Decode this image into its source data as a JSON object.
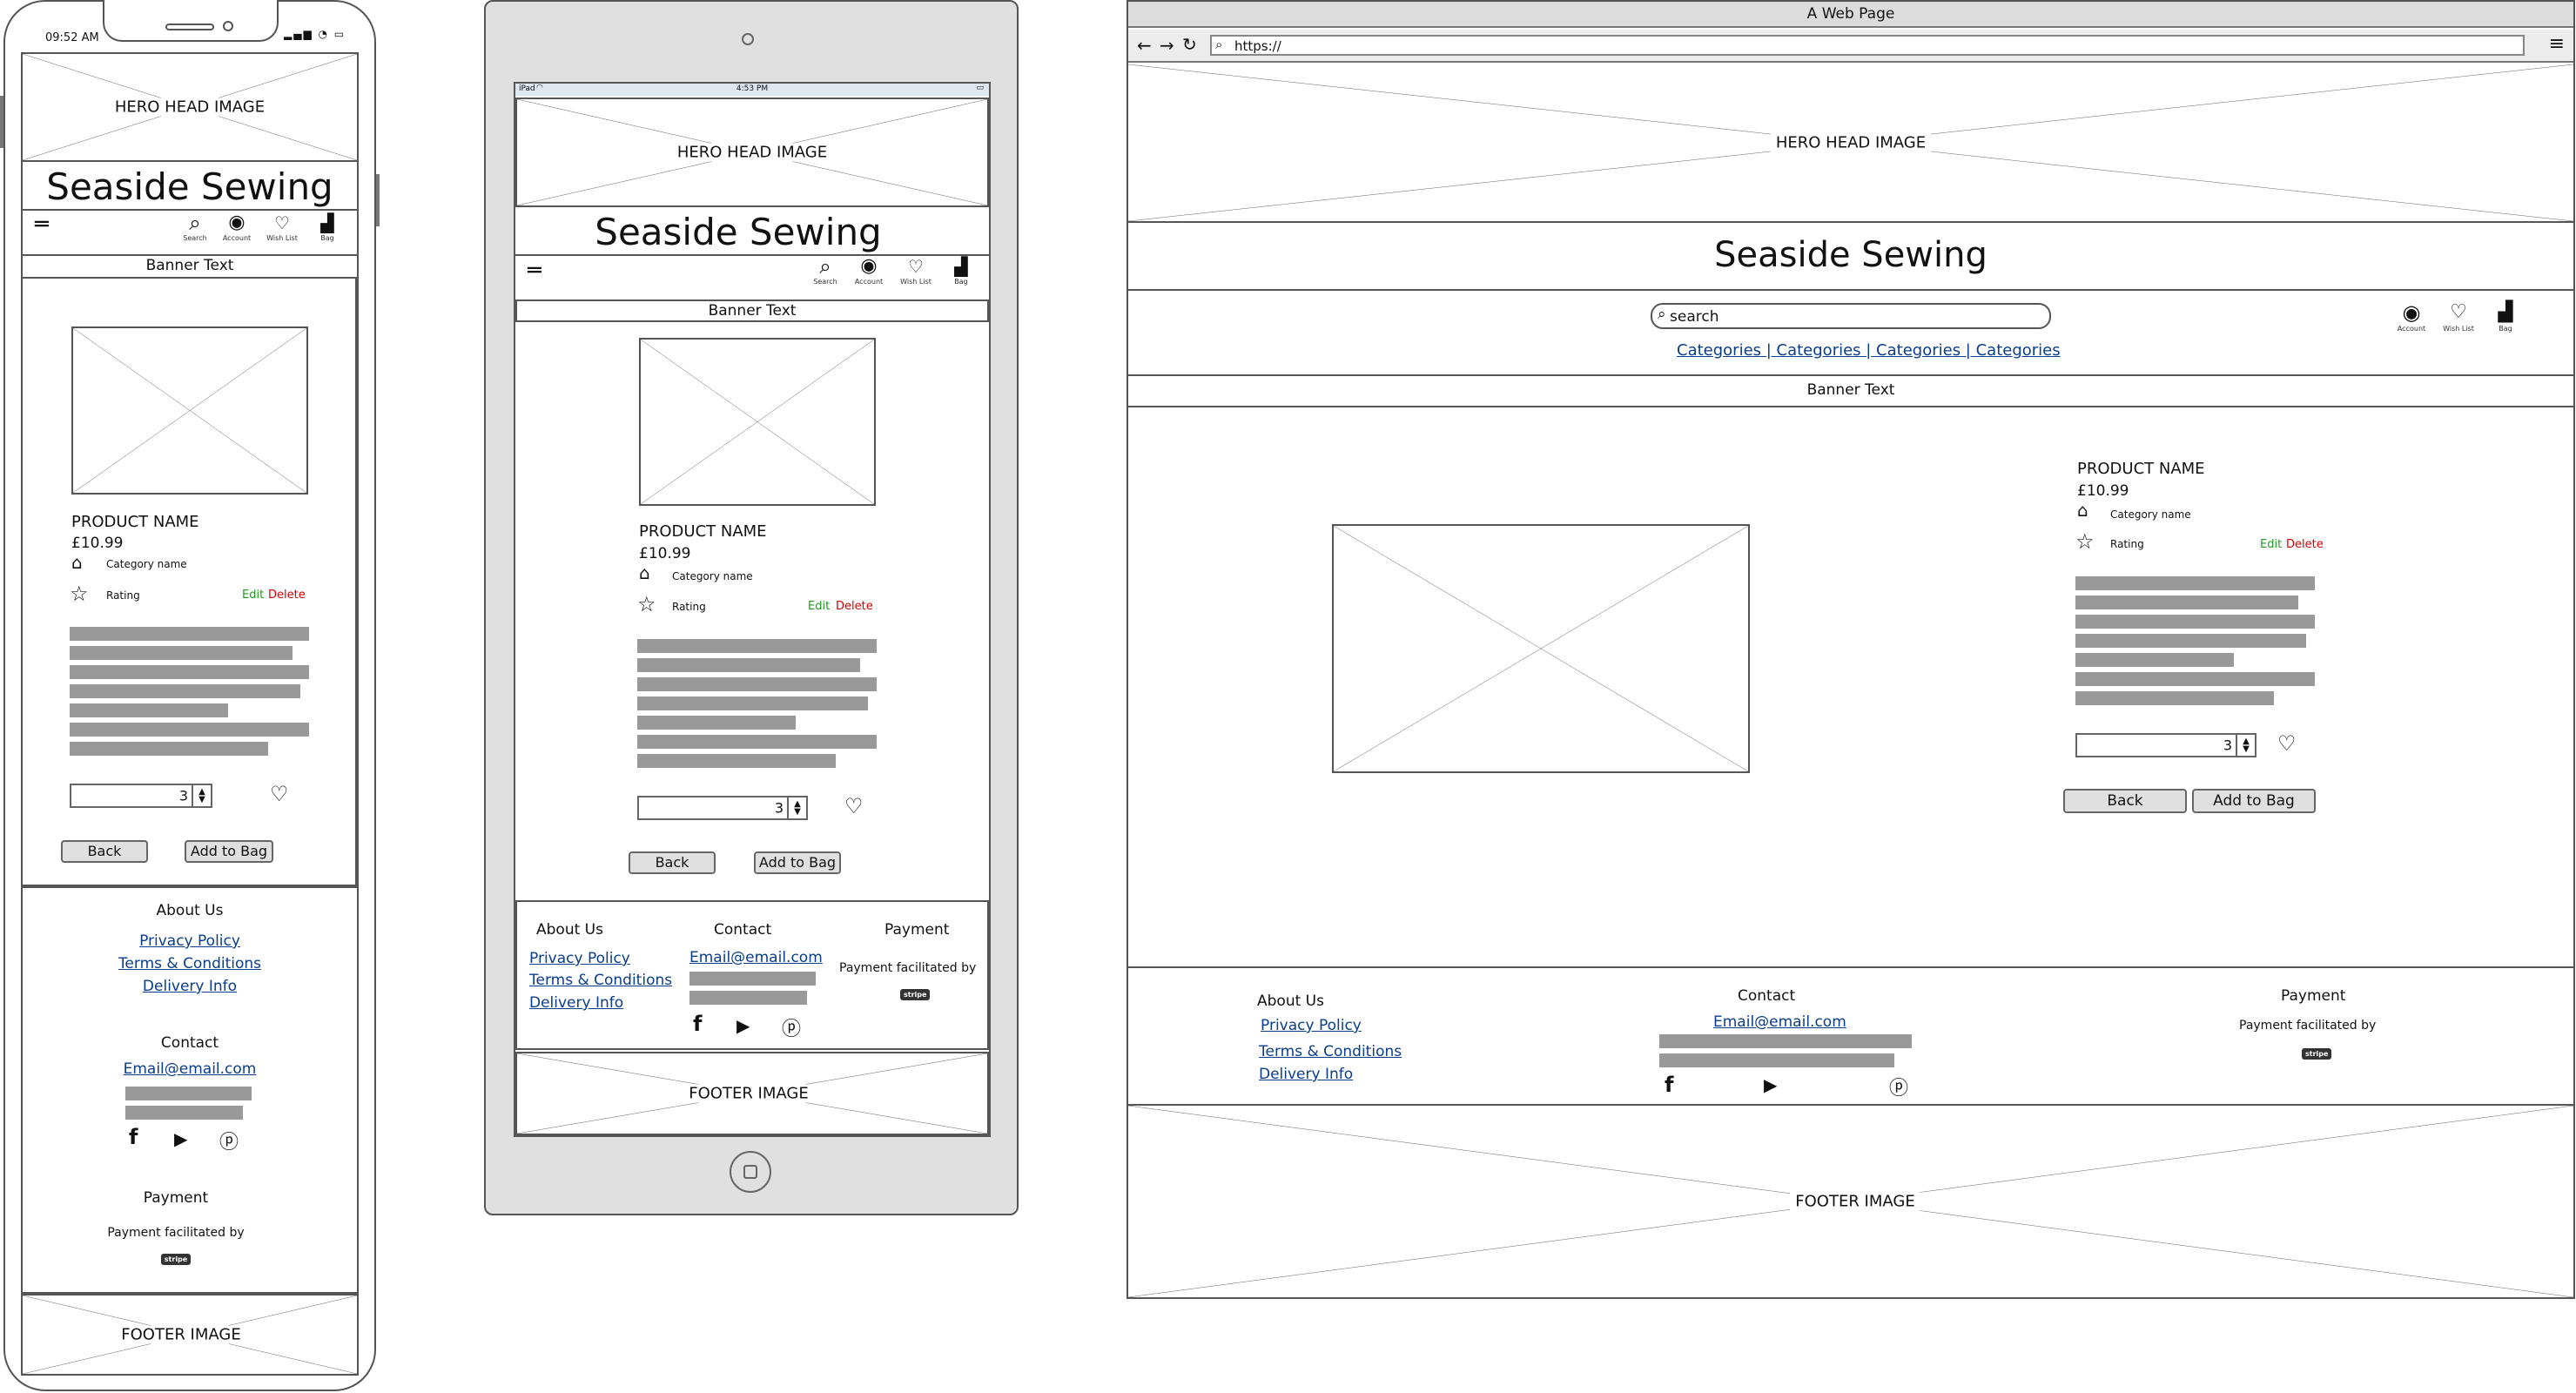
{
  "store_name": "Seaside Sewing",
  "hero_label": "HERO HEAD IMAGE",
  "footer_image_label": "FOOTER IMAGE",
  "banner_text": "Banner Text",
  "nav": {
    "search": "Search",
    "account": "Account",
    "wishlist": "Wish List",
    "bag": "Bag"
  },
  "product": {
    "name": "PRODUCT NAME",
    "price": "£10.99",
    "category": "Category name",
    "rating": "Rating",
    "edit": "Edit",
    "delete": "Delete",
    "quantity": "3"
  },
  "buttons": {
    "back": "Back",
    "add_to_bag": "Add to Bag"
  },
  "footer": {
    "about_heading": "About Us",
    "privacy": "Privacy Policy",
    "terms": "Terms & Conditions",
    "delivery": "Delivery Info",
    "contact_heading": "Contact",
    "email": "Email@email.com",
    "payment_heading": "Payment",
    "payment_text": "Payment facilitated by",
    "stripe": "stripe"
  },
  "phone_status": {
    "time": "09:52 AM"
  },
  "tablet_status": {
    "device": "iPad",
    "time": "4:53 PM"
  },
  "browser": {
    "window_title": "A Web Page",
    "url": "https://",
    "search_placeholder": "search",
    "categories": "Categories | Categories | Categories | Categories"
  },
  "colors": {
    "edit": "#1f9a1f",
    "delete": "#d40000",
    "link": "#0a3d8c",
    "grey_bar": "#999999",
    "tablet_bezel": "#e0e0e0"
  }
}
